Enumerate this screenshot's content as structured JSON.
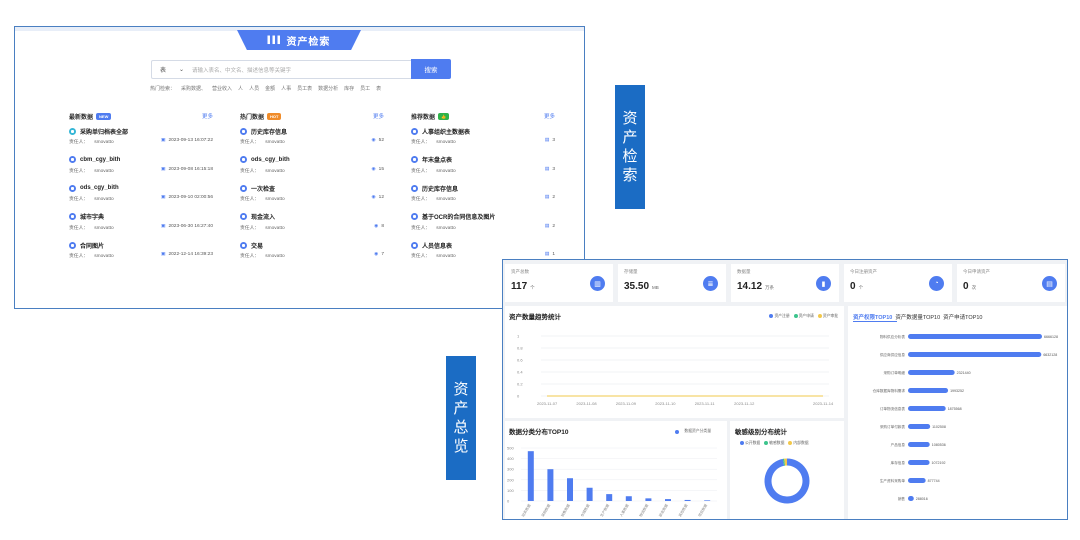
{
  "search_panel": {
    "banner_title": "资产检索",
    "search_select": "表",
    "search_placeholder": "请输入表名、中文名、描述信息等关键字",
    "search_button": "搜索",
    "hot_label": "热门检索：",
    "hot_words": [
      "采购数据、",
      "营业收入",
      "人",
      "人员",
      "金额",
      "人事",
      "员工表",
      "数据分析",
      "库存",
      "员工",
      "表"
    ],
    "columns": [
      {
        "title": "最新数据",
        "tag": "NEW",
        "tag_color": "#4f7cf0",
        "more": "更多",
        "items": [
          {
            "name": "采购单归档表全部",
            "owner": "责任人：",
            "owner_name": "smovatto",
            "right": "2023-09-13 16:07:22"
          },
          {
            "name": "cbm_cgy_bith",
            "owner": "责任人：",
            "owner_name": "smovatto",
            "right": "2023-09-08 16:15:18"
          },
          {
            "name": "ods_cgy_bith",
            "owner": "责任人：",
            "owner_name": "smovatto",
            "right": "2023-09-10 02:00:56"
          },
          {
            "name": "城市字典",
            "owner": "责任人：",
            "owner_name": "smovatto",
            "right": "2023-06-30 16:27:40"
          },
          {
            "name": "合同图片",
            "owner": "责任人：",
            "owner_name": "smovatto",
            "right": "2022-12-14 16:39:23"
          }
        ]
      },
      {
        "title": "热门数据",
        "tag": "HOT",
        "tag_color": "#f08c2a",
        "more": "更多",
        "items": [
          {
            "name": "历史库存信息",
            "owner": "责任人：",
            "owner_name": "smovatto",
            "right": "52"
          },
          {
            "name": "ods_cgy_bith",
            "owner": "责任人：",
            "owner_name": "smovatto",
            "right": "15"
          },
          {
            "name": "一次检查",
            "owner": "责任人：",
            "owner_name": "smovatto",
            "right": "12"
          },
          {
            "name": "现金流入",
            "owner": "责任人：",
            "owner_name": "smovatto",
            "right": "8"
          },
          {
            "name": "交易",
            "owner": "责任人：",
            "owner_name": "smovatto",
            "right": "7"
          }
        ]
      },
      {
        "title": "推荐数据",
        "tag": "👍",
        "tag_color": "#2fb34a",
        "more": "更多",
        "items": [
          {
            "name": "人事组织主数据表",
            "owner": "责任人：",
            "owner_name": "smovatto",
            "right": "3"
          },
          {
            "name": "年末盘点表",
            "owner": "责任人：",
            "owner_name": "smovatto",
            "right": "3"
          },
          {
            "name": "历史库存信息",
            "owner": "责任人：",
            "owner_name": "smovatto",
            "right": "2"
          },
          {
            "name": "基于OCR的合同信息及图片",
            "owner": "责任人：",
            "owner_name": "smovatto",
            "right": "2"
          },
          {
            "name": "人员信息表",
            "owner": "责任人：",
            "owner_name": "smovatto",
            "right": "1"
          }
        ]
      }
    ]
  },
  "labels": {
    "search": [
      "资",
      "产",
      "检",
      "索"
    ],
    "overview": [
      "资",
      "产",
      "总",
      "览"
    ]
  },
  "dashboard": {
    "stats": [
      {
        "label": "资产总数",
        "value": "117",
        "unit": "个",
        "icon": "building-icon"
      },
      {
        "label": "存储量",
        "value": "35.50",
        "unit": "MB",
        "icon": "database-icon"
      },
      {
        "label": "数据量",
        "value": "14.12",
        "unit": "万条",
        "icon": "chart-icon"
      },
      {
        "label": "今日注册资产",
        "value": "0",
        "unit": "个",
        "icon": "pie-icon"
      },
      {
        "label": "今日申请资产",
        "value": "0",
        "unit": "次",
        "icon": "document-icon"
      }
    ],
    "trend": {
      "title": "资产数量趋势统计",
      "legend": [
        "资产注册",
        "资产申请",
        "资产审批"
      ],
      "legend_colors": [
        "#4f7cf0",
        "#3cc48c",
        "#f2c84b"
      ]
    },
    "category": {
      "title": "数据分类分布TOP10",
      "legend": "数据资产分类量"
    },
    "sensitivity": {
      "title": "敏感级别分布统计",
      "legend": [
        "公开数据",
        "敏感数据",
        "内部数据"
      ],
      "legend_colors": [
        "#4f7cf0",
        "#3cc48c",
        "#f2c84b"
      ]
    },
    "top_tabs": [
      "资产权限TOP10",
      "资产数据量TOP10",
      "资产申请TOP10"
    ]
  },
  "chart_data": [
    {
      "type": "line",
      "title": "资产数量趋势统计",
      "x": [
        "2023-11-07",
        "2023-11-08",
        "2023-11-09",
        "2023-11-10",
        "2023-11-11",
        "2023-11-12",
        "2023-11-13",
        "2023-11-14"
      ],
      "x_tick_labels": [
        "2023-11-07",
        "2023-11-08",
        "2023-11-09",
        "2023-11-10",
        "2023-11-11",
        "2023-11-12",
        "2023-11-14"
      ],
      "ylim": [
        0,
        1
      ],
      "y_ticks": [
        "1",
        "0.8",
        "0.6",
        "0.4",
        "0.2",
        "0"
      ],
      "series": [
        {
          "name": "资产注册",
          "values": [
            0,
            0,
            0,
            0,
            0,
            0,
            0,
            0
          ]
        },
        {
          "name": "资产申请",
          "values": [
            0,
            0,
            0,
            0,
            0,
            0,
            0,
            0
          ]
        },
        {
          "name": "资产审批",
          "values": [
            0,
            0,
            0,
            0,
            0,
            0,
            0,
            0
          ]
        }
      ],
      "grid": true,
      "legend": "top-right"
    },
    {
      "type": "bar",
      "title": "数据分类分布TOP10",
      "categories": [
        "财务数据",
        "采购数据",
        "销售数据",
        "仓储数据",
        "生产数据",
        "人事数据",
        "物流数据",
        "研发数据",
        "其他数据",
        "项目数据"
      ],
      "values": [
        470,
        300,
        215,
        125,
        65,
        45,
        25,
        18,
        10,
        6
      ],
      "ylim": [
        0,
        500
      ],
      "y_ticks": [
        "500",
        "400",
        "300",
        "200",
        "100",
        "0"
      ],
      "series": [
        {
          "name": "数据资产分类量"
        }
      ],
      "legend": "top-right"
    },
    {
      "type": "pie",
      "title": "敏感级别分布统计",
      "categories": [
        "公开数据",
        "敏感数据",
        "内部数据"
      ],
      "values": [
        97,
        1,
        2
      ],
      "legend": "top"
    },
    {
      "type": "bar",
      "title": "资产权限TOP10",
      "orientation": "horizontal",
      "categories": [
        "物料供应分析表",
        "供应商供应信息",
        "采购订单明细",
        "仓库数据库物料需求",
        "订单物流信息表",
        "采购订单付款表",
        "产品信息",
        "库存信息",
        "生产资料采购单",
        "销售"
      ],
      "values": [
        6666128,
        6632128,
        2321440,
        1993252,
        1875568,
        1102508,
        1080536,
        1072192,
        877744,
        288016
      ],
      "value_labels": [
        "6666128",
        "6632128",
        "2321440",
        "1993252",
        "1875568",
        "1102508",
        "1080536",
        "1072192",
        "877744",
        "288016"
      ]
    }
  ]
}
